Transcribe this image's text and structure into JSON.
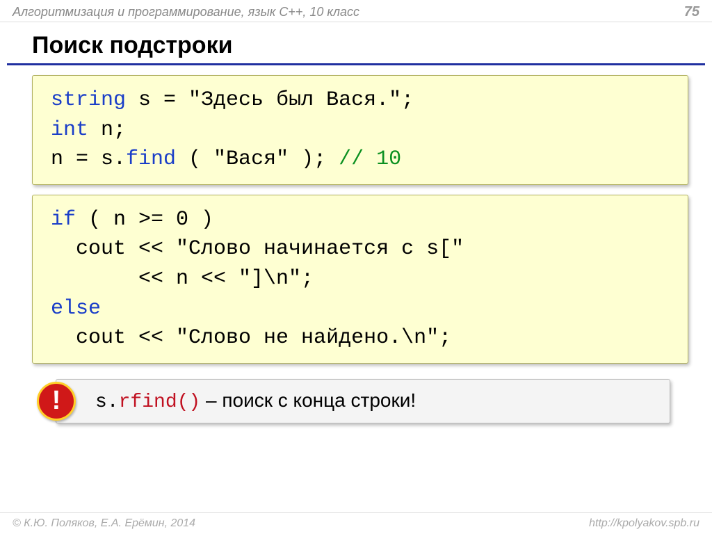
{
  "header": {
    "course": "Алгоритмизация и программирование, язык С++, 10 класс",
    "page": "75"
  },
  "title": "Поиск подстроки",
  "code1": {
    "t1a": "string",
    "t1b": " s = \"Здесь был Вася.\";",
    "t2a": "int",
    "t2b": " n;",
    "t3a": "n = s.",
    "t3b": "find",
    "t3c": " ( \"Вася\" );  ",
    "t3d": "// 10"
  },
  "code2": {
    "l1a": "if",
    "l1b": " ( n >= 0 )",
    "l2a": "  cout << \"Слово начинается с s[\"",
    "l3a": "       << n << \"]\\n\";",
    "l4a": "else",
    "l5a": "  cout << \"Слово не найдено.\\n\";"
  },
  "note": {
    "badge": "!",
    "pre": "s.",
    "func": "rfind()",
    "post": " – поиск с конца строки!"
  },
  "footer": {
    "left": "© К.Ю. Поляков, Е.А. Ерёмин, 2014",
    "right": "http://kpolyakov.spb.ru"
  }
}
